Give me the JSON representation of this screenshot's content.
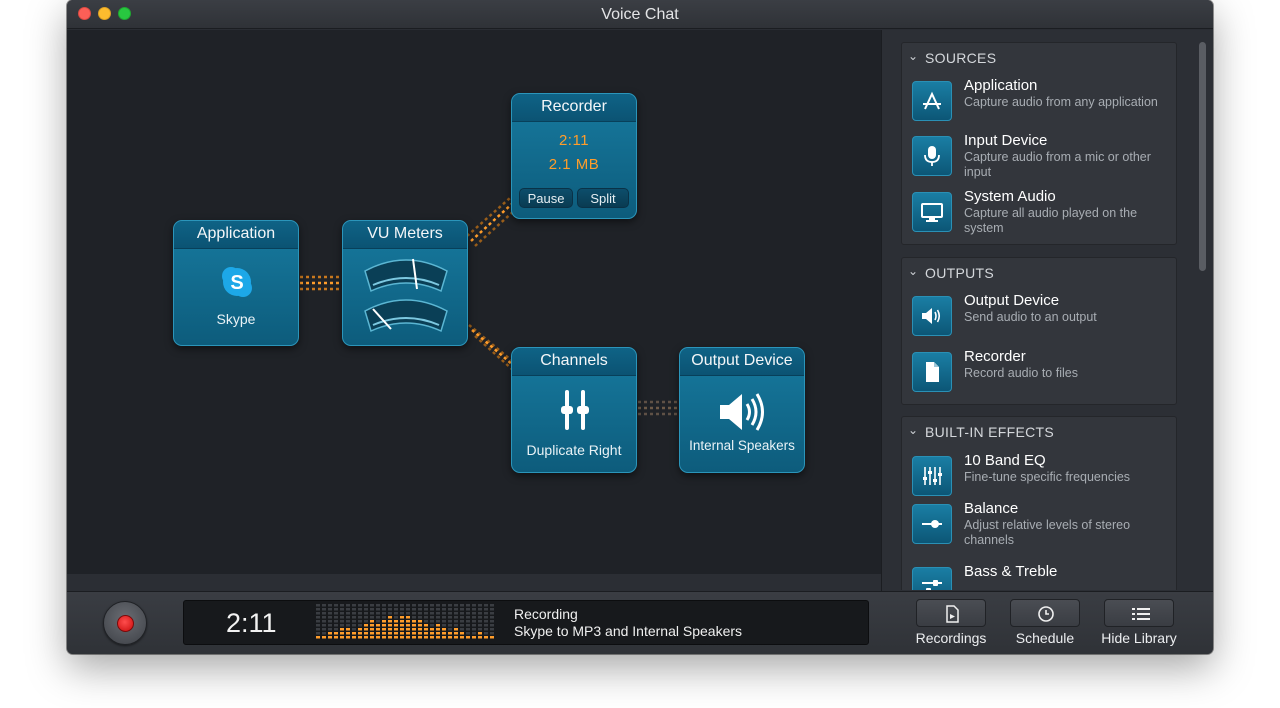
{
  "window": {
    "title": "Voice Chat"
  },
  "nodes": {
    "application": {
      "title": "Application",
      "subtitle": "Skype",
      "icon": "skype-icon"
    },
    "vu_meters": {
      "title": "VU Meters",
      "icon": "vu-meter-icon"
    },
    "recorder": {
      "title": "Recorder",
      "time": "2:11",
      "size": "2.1 MB",
      "pause_label": "Pause",
      "split_label": "Split"
    },
    "channels": {
      "title": "Channels",
      "subtitle": "Duplicate Right",
      "icon": "sliders-icon"
    },
    "output_device": {
      "title": "Output Device",
      "subtitle": "Internal Speakers",
      "icon": "speaker-icon"
    }
  },
  "library": {
    "sources": {
      "title": "SOURCES",
      "items": [
        {
          "title": "Application",
          "desc": "Capture audio from any application",
          "icon": "app-store-icon"
        },
        {
          "title": "Input Device",
          "desc": "Capture audio from a mic or other input",
          "icon": "microphone-icon"
        },
        {
          "title": "System Audio",
          "desc": "Capture all audio played on the system",
          "icon": "monitor-icon"
        }
      ]
    },
    "outputs": {
      "title": "OUTPUTS",
      "items": [
        {
          "title": "Output Device",
          "desc": "Send audio to an output",
          "icon": "speaker-icon"
        },
        {
          "title": "Recorder",
          "desc": "Record audio to files",
          "icon": "file-icon"
        }
      ]
    },
    "effects": {
      "title": "BUILT-IN EFFECTS",
      "items": [
        {
          "title": "10 Band EQ",
          "desc": "Fine-tune specific frequencies",
          "icon": "eq-icon"
        },
        {
          "title": "Balance",
          "desc": "Adjust relative levels of stereo channels",
          "icon": "balance-icon"
        },
        {
          "title": "Bass & Treble",
          "desc": "",
          "icon": "bass-treble-icon"
        }
      ]
    }
  },
  "bottom": {
    "time": "2:11",
    "status": "Recording",
    "detail": "Skype to MP3 and Internal Speakers",
    "recordings_label": "Recordings",
    "schedule_label": "Schedule",
    "hide_library_label": "Hide Library"
  },
  "colors": {
    "accent": "#ff9d2b",
    "node": "#177a9f",
    "record": "#e01515"
  }
}
